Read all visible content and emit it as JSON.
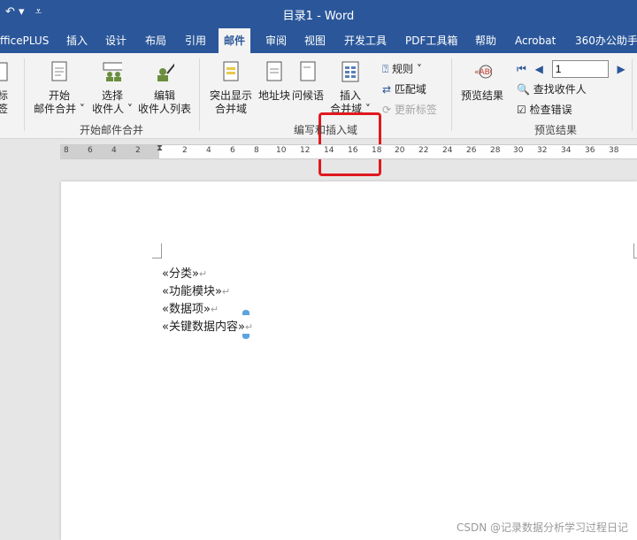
{
  "window": {
    "title": "目录1 - Word",
    "qat_icons": [
      "quick-access-arrow-icon",
      "customize-qat-icon"
    ]
  },
  "tabs": [
    "fficePLUS",
    "插入",
    "设计",
    "布局",
    "引用",
    "邮件",
    "审阅",
    "视图",
    "开发工具",
    "PDF工具箱",
    "帮助",
    "Acrobat",
    "360办公助手"
  ],
  "active_tab": "邮件",
  "ribbon": {
    "clip_left": {
      "line1": "标",
      "line2": "签"
    },
    "group1": {
      "name": "开始邮件合并",
      "start_merge": {
        "line1": "开始",
        "line2": "邮件合并"
      },
      "select_recipients": {
        "line1": "选择",
        "line2": "收件人"
      },
      "edit_recipients": {
        "line1": "编辑",
        "line2": "收件人列表"
      }
    },
    "group2": {
      "name": "编写和插入域",
      "highlight_fields": {
        "line1": "突出显示",
        "line2": "合并域"
      },
      "address_block": {
        "line1": "地址块"
      },
      "greeting_line": {
        "line1": "问候语"
      },
      "insert_merge_field": {
        "line1": "插入",
        "line2": "合并域"
      },
      "rules": "规则",
      "match_fields": "匹配域",
      "update_labels": "更新标签"
    },
    "group3": {
      "name": "预览结果",
      "preview_results": {
        "line1": "预览结果"
      },
      "record_number": "1",
      "find_recipient": "查找收件人",
      "check_errors": "检查错误"
    }
  },
  "ruler": {
    "left_ticks": [
      "8",
      "6",
      "4",
      "2"
    ],
    "right_ticks": [
      "2",
      "4",
      "6",
      "8",
      "10",
      "12",
      "14",
      "16",
      "18",
      "20",
      "22",
      "24",
      "26",
      "28",
      "30",
      "32",
      "34",
      "36",
      "38"
    ]
  },
  "document": {
    "lines": [
      "«分类»",
      "«功能模块»",
      "«数据项»",
      "«关键数据内容»"
    ],
    "paragraph_mark": "↵"
  },
  "watermark": "CSDN @记录数据分析学习过程日记"
}
